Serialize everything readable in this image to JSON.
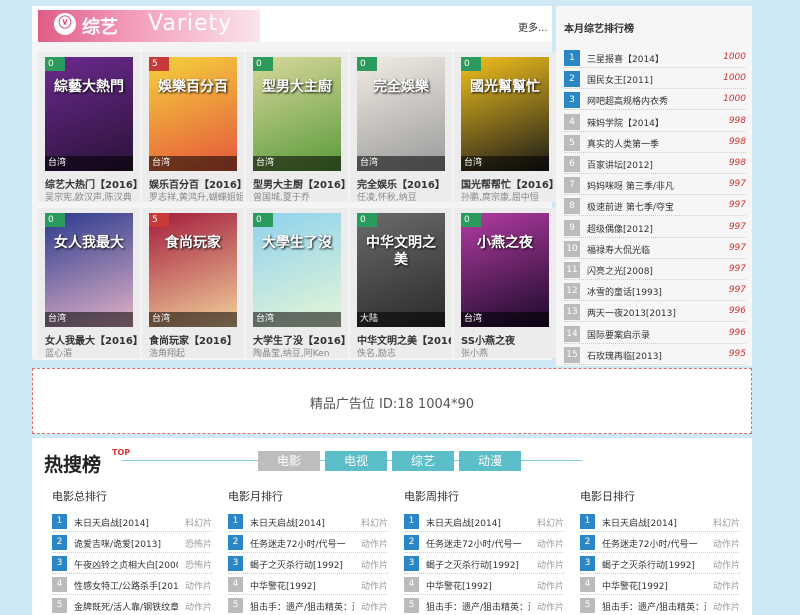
{
  "variety": {
    "logo_cn": "综艺",
    "logo_en": "Variety",
    "more": "更多...",
    "cards": [
      {
        "score": "0",
        "region": "台湾",
        "poster_text": "綜藝大熱門",
        "poster_colors": [
          "#6b2a8e",
          "#2a1238"
        ],
        "title": "综艺大热门【2016】",
        "actors": "吴宗宪,欧汉声,陈汉典"
      },
      {
        "score": "5",
        "region": "台湾",
        "poster_text": "娛樂百分百",
        "poster_colors": [
          "#f4d23c",
          "#e6563c"
        ],
        "title": "娱乐百分百【2016】",
        "actors": "罗志祥,黄鸿升,蝴蝶姐姐"
      },
      {
        "score": "0",
        "region": "台湾",
        "poster_text": "型男大主廚",
        "poster_colors": [
          "#d8d89c",
          "#5a9a3a"
        ],
        "title": "型男大主厨【2016】",
        "actors": "曾国城,夏于乔"
      },
      {
        "score": "0",
        "region": "台湾",
        "poster_text": "完全娛樂",
        "poster_colors": [
          "#f2ece4",
          "#9a9a9a"
        ],
        "title": "完全娱乐【2016】",
        "actors": "任凌,怀秋,纳豆"
      },
      {
        "score": "0",
        "region": "台湾",
        "poster_text": "國光幫幫忙",
        "poster_colors": [
          "#f3c21c",
          "#1a1a1a"
        ],
        "title": "国光帮帮忙【2016】",
        "actors": "孙鹏,庹宗康,屈中恒"
      },
      {
        "score": "0",
        "region": "台湾",
        "poster_text": "女人我最大",
        "poster_colors": [
          "#2a3a8e",
          "#e2b2c6"
        ],
        "title": "女人我最大【2016】",
        "actors": "蓝心湄"
      },
      {
        "score": "5",
        "region": "台湾",
        "poster_text": "食尚玩家",
        "poster_colors": [
          "#a31c3c",
          "#f2d29c"
        ],
        "title": "食尚玩家【2016】",
        "actors": "浩角翔起"
      },
      {
        "score": "0",
        "region": "台湾",
        "poster_text": "大學生了沒",
        "poster_colors": [
          "#8ed2ee",
          "#e6f6d6"
        ],
        "title": "大学生了没【2016】",
        "actors": "陶晶莹,纳豆,阿Ken"
      },
      {
        "score": "0",
        "region": "大陆",
        "poster_text": "中华文明之美",
        "poster_colors": [
          "#6b6b6b",
          "#2a2a2a"
        ],
        "title": "中华文明之美【2016】",
        "actors": "佚名,励志"
      },
      {
        "score": "0",
        "region": "台湾",
        "poster_text": "小燕之夜",
        "poster_colors": [
          "#b23ca2",
          "#1a0a2a"
        ],
        "title": "SS小燕之夜",
        "actors": "张小燕"
      }
    ]
  },
  "ranking": {
    "title": "本月综艺排行榜",
    "items": [
      {
        "rank": "1",
        "name": "三星报喜【2014】",
        "score": "1000"
      },
      {
        "rank": "2",
        "name": "国民女王[2011]",
        "score": "1000"
      },
      {
        "rank": "3",
        "name": "网吧超高规格内衣秀",
        "score": "1000"
      },
      {
        "rank": "4",
        "name": "辣妈学院【2014】",
        "score": "998"
      },
      {
        "rank": "5",
        "name": "真实的人类第一季",
        "score": "998"
      },
      {
        "rank": "6",
        "name": "百家讲坛[2012]",
        "score": "998"
      },
      {
        "rank": "7",
        "name": "妈妈咪呀 第三季/非凡",
        "score": "997"
      },
      {
        "rank": "8",
        "name": "极速前进 第七季/夺宝",
        "score": "997"
      },
      {
        "rank": "9",
        "name": "超级偶像[2012]",
        "score": "997"
      },
      {
        "rank": "10",
        "name": "福禄寿大侃光临",
        "score": "997"
      },
      {
        "rank": "11",
        "name": "闪亮之光[2008]",
        "score": "997"
      },
      {
        "rank": "12",
        "name": "冰雪的童话[1993]",
        "score": "997"
      },
      {
        "rank": "13",
        "name": "两天一夜2013[2013]",
        "score": "996"
      },
      {
        "rank": "14",
        "name": "国际要案启示录",
        "score": "996"
      },
      {
        "rank": "15",
        "name": "石玫瑰再临[2013]",
        "score": "995"
      }
    ]
  },
  "ad": {
    "text": "精品广告位 ID:18 1004*90"
  },
  "hot": {
    "title": "热搜榜",
    "top_tag": "TOP",
    "tabs": [
      "电影",
      "电视",
      "综艺",
      "动漫"
    ],
    "columns": [
      {
        "title": "电影总排行",
        "items": [
          {
            "rank": "1",
            "name": "末日天启战[2014]",
            "genre": "科幻片"
          },
          {
            "rank": "2",
            "name": "诡爱吉咪/诡爱[2013]",
            "genre": "恐怖片"
          },
          {
            "rank": "3",
            "name": "午夜凶铃之贞相大白[2000]",
            "genre": "恐怖片"
          },
          {
            "rank": "4",
            "name": "性感女特工/公路杀手[2011]",
            "genre": "动作片"
          },
          {
            "rank": "5",
            "name": "金牌既死/活人靠/钢铁纹章/",
            "genre": "动作片"
          }
        ]
      },
      {
        "title": "电影月排行",
        "items": [
          {
            "rank": "1",
            "name": "末日天启战[2014]",
            "genre": "科幻片"
          },
          {
            "rank": "2",
            "name": "任务迷走72小时/代号一",
            "genre": "动作片"
          },
          {
            "rank": "3",
            "name": "蝎子之灭杀行动[1992]",
            "genre": "动作片"
          },
          {
            "rank": "4",
            "name": "中华警花[1992]",
            "genre": "动作片"
          },
          {
            "rank": "5",
            "name": "狙击手：遗产/狙击精英：遗",
            "genre": "动作片"
          }
        ]
      },
      {
        "title": "电影周排行",
        "items": [
          {
            "rank": "1",
            "name": "末日天启战[2014]",
            "genre": "科幻片"
          },
          {
            "rank": "2",
            "name": "任务迷走72小时/代号一",
            "genre": "动作片"
          },
          {
            "rank": "3",
            "name": "蝎子之灭杀行动[1992]",
            "genre": "动作片"
          },
          {
            "rank": "4",
            "name": "中华警花[1992]",
            "genre": "动作片"
          },
          {
            "rank": "5",
            "name": "狙击手：遗产/狙击精英：遗",
            "genre": "动作片"
          }
        ]
      },
      {
        "title": "电影日排行",
        "items": [
          {
            "rank": "1",
            "name": "末日天启战[2014]",
            "genre": "科幻片"
          },
          {
            "rank": "2",
            "name": "任务迷走72小时/代号一",
            "genre": "动作片"
          },
          {
            "rank": "3",
            "name": "蝎子之灭杀行动[1992]",
            "genre": "动作片"
          },
          {
            "rank": "4",
            "name": "中华警花[1992]",
            "genre": "动作片"
          },
          {
            "rank": "5",
            "name": "狙击手：遗产/狙击精英：遗",
            "genre": "动作片"
          }
        ]
      }
    ]
  }
}
